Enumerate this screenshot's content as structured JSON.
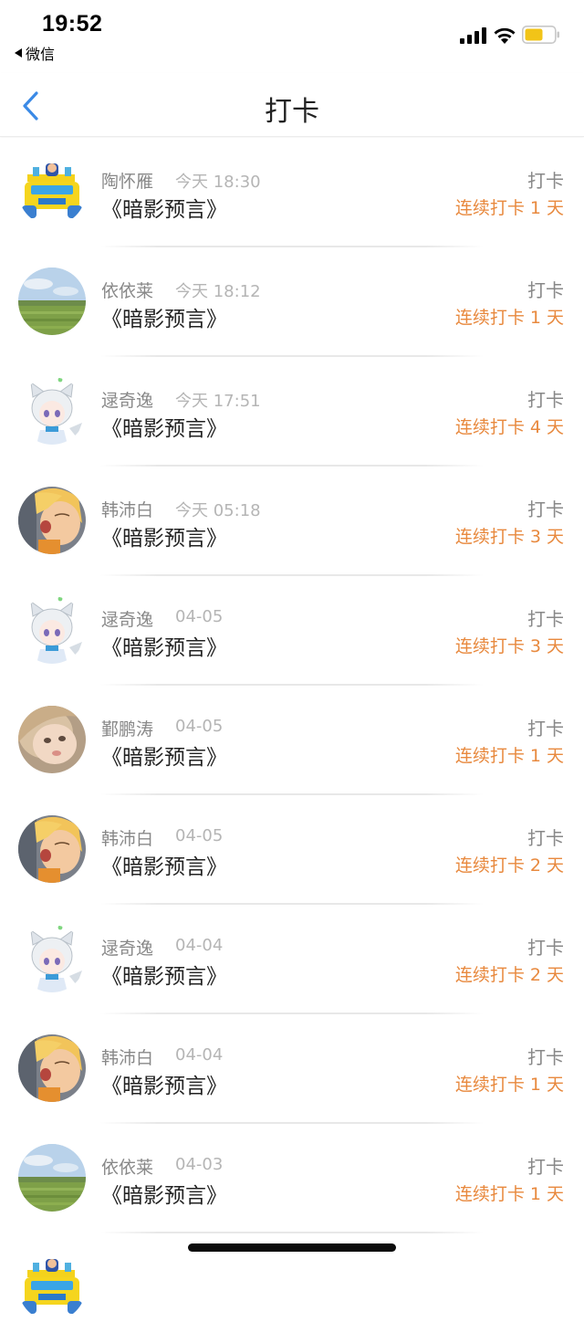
{
  "status_bar": {
    "time": "19:52",
    "back_app": "微信"
  },
  "nav": {
    "title": "打卡"
  },
  "colors": {
    "streak": "#e8893e",
    "back_arrow": "#3b8ae6"
  },
  "items": [
    {
      "name": "陶怀雁",
      "date": "今天 18:30",
      "book": "《暗影预言》",
      "action": "打卡",
      "streak": "连续打卡 1 天",
      "avatar": "toy-car-avatar"
    },
    {
      "name": "依依莱",
      "date": "今天 18:12",
      "book": "《暗影预言》",
      "action": "打卡",
      "streak": "连续打卡 1 天",
      "avatar": "field-avatar"
    },
    {
      "name": "逯奇逸",
      "date": "今天 17:51",
      "book": "《暗影预言》",
      "action": "打卡",
      "streak": "连续打卡 4 天",
      "avatar": "anime-cat-avatar"
    },
    {
      "name": "韩沛白",
      "date": "今天 05:18",
      "book": "《暗影预言》",
      "action": "打卡",
      "streak": "连续打卡 3 天",
      "avatar": "cartoon-face-avatar"
    },
    {
      "name": "逯奇逸",
      "date": "04-05",
      "book": "《暗影预言》",
      "action": "打卡",
      "streak": "连续打卡 3 天",
      "avatar": "anime-cat-avatar"
    },
    {
      "name": "鄞鹏涛",
      "date": "04-05",
      "book": "《暗影预言》",
      "action": "打卡",
      "streak": "连续打卡 1 天",
      "avatar": "child-photo-avatar"
    },
    {
      "name": "韩沛白",
      "date": "04-05",
      "book": "《暗影预言》",
      "action": "打卡",
      "streak": "连续打卡 2 天",
      "avatar": "cartoon-face-avatar"
    },
    {
      "name": "逯奇逸",
      "date": "04-04",
      "book": "《暗影预言》",
      "action": "打卡",
      "streak": "连续打卡 2 天",
      "avatar": "anime-cat-avatar"
    },
    {
      "name": "韩沛白",
      "date": "04-04",
      "book": "《暗影预言》",
      "action": "打卡",
      "streak": "连续打卡 1 天",
      "avatar": "cartoon-face-avatar"
    },
    {
      "name": "依依莱",
      "date": "04-03",
      "book": "《暗影预言》",
      "action": "打卡",
      "streak": "连续打卡 1 天",
      "avatar": "field-avatar"
    },
    {
      "name": "",
      "date": "",
      "book": "",
      "action": "",
      "streak": "",
      "avatar": "toy-car-avatar"
    }
  ]
}
